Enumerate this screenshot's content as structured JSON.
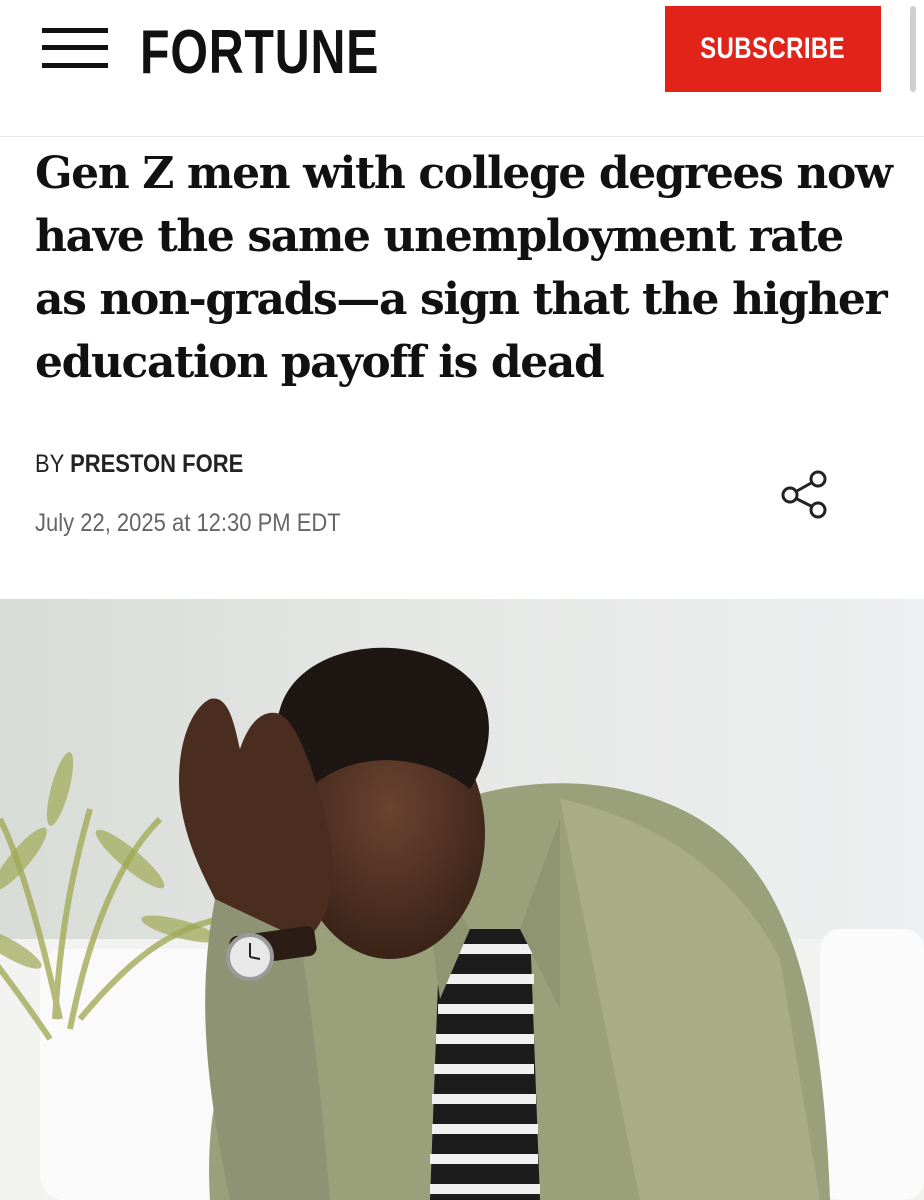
{
  "header": {
    "logo": "FORTUNE",
    "subscribe_label": "SUBSCRIBE"
  },
  "article": {
    "headline": "Gen Z men with college degrees now have the same unemployment rate as non-grads—a sign that the higher education payoff is dead",
    "byline_prefix": "BY",
    "author": "PRESTON FORE",
    "date": "July 22, 2025 at 12:30 PM EDT"
  },
  "colors": {
    "brand_red": "#e2231a"
  },
  "icons": {
    "menu": "hamburger-menu-icon",
    "share": "share-icon"
  }
}
